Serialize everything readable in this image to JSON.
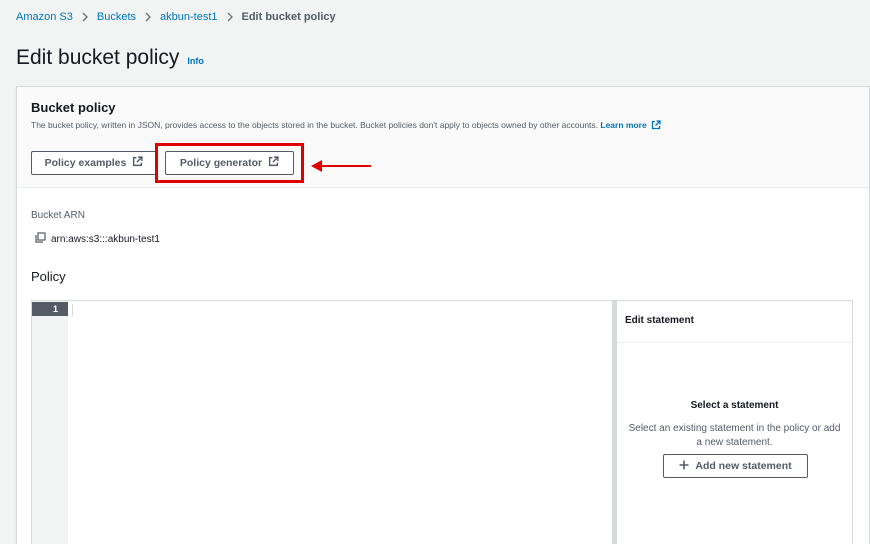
{
  "breadcrumb": {
    "items": [
      {
        "label": "Amazon S3"
      },
      {
        "label": "Buckets"
      },
      {
        "label": "akbun-test1"
      },
      {
        "label": "Edit bucket policy"
      }
    ]
  },
  "page": {
    "title": "Edit bucket policy",
    "info_label": "Info"
  },
  "bucket_policy": {
    "title": "Bucket policy",
    "description": "The bucket policy, written in JSON, provides access to the objects stored in the bucket. Bucket policies don't apply to objects owned by other accounts.",
    "learn_more_label": "Learn more",
    "policy_examples_label": "Policy examples",
    "policy_generator_label": "Policy generator"
  },
  "bucket_arn": {
    "label": "Bucket ARN",
    "value": "arn:aws:s3:::akbun-test1"
  },
  "policy": {
    "label": "Policy",
    "line_number": "1"
  },
  "statement_panel": {
    "header": "Edit statement",
    "title": "Select a statement",
    "description": "Select an existing statement in the policy or add a new statement.",
    "add_button_label": "Add new statement"
  },
  "colors": {
    "link": "#0073bb",
    "highlight": "#e00000",
    "button_border": "#545b64"
  },
  "icons": {
    "breadcrumb_separator": "chevron-right-icon",
    "external_link": "external-link-icon",
    "copy": "copy-icon",
    "add": "plus-icon",
    "annotation": "arrow-left-icon"
  }
}
